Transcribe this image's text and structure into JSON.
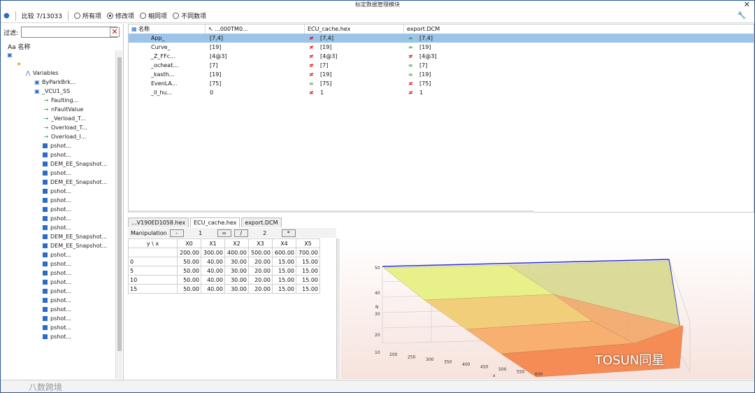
{
  "window": {
    "title": "标定数据管理模块",
    "close": "✕"
  },
  "toolbar": {
    "count_label": "比较",
    "count_value": "7/13033",
    "options": [
      {
        "label": "所有项",
        "selected": false
      },
      {
        "label": "修改项",
        "selected": true
      },
      {
        "label": "相同项",
        "selected": false
      },
      {
        "label": "不同数项",
        "selected": false
      }
    ]
  },
  "left": {
    "filter_label": "过滤:",
    "filter_value": "",
    "name_header": "Aa 名称",
    "tree": [
      {
        "label": "",
        "indent": 0,
        "icon": "folder"
      },
      {
        "label": "",
        "indent": 1,
        "icon": "star"
      },
      {
        "label": "Variables",
        "indent": 2,
        "icon": "variable"
      },
      {
        "label": "ByParkBrk...",
        "indent": 3,
        "icon": "folder"
      },
      {
        "label": "_VCU1_SS",
        "indent": 3,
        "icon": "folder"
      },
      {
        "label": "Faulting...",
        "indent": 4,
        "icon": "arrow"
      },
      {
        "label": "nFaultValue",
        "indent": 4,
        "icon": "arrow"
      },
      {
        "label": "_Verload_T...",
        "indent": 4,
        "icon": "arrow"
      },
      {
        "label": "Overload_T...",
        "indent": 4,
        "icon": "arrow"
      },
      {
        "label": "Overload_I...",
        "indent": 4,
        "icon": "arrow"
      },
      {
        "label": "pshot...",
        "indent": 4,
        "icon": "grid"
      },
      {
        "label": "pshot...",
        "indent": 4,
        "icon": "grid"
      },
      {
        "label": "DEM_EE_Snapshot...",
        "indent": 4,
        "icon": "grid"
      },
      {
        "label": "pshot...",
        "indent": 4,
        "icon": "grid"
      },
      {
        "label": "DEM_EE_Snapshot...",
        "indent": 4,
        "icon": "grid"
      },
      {
        "label": "pshot...",
        "indent": 4,
        "icon": "grid"
      },
      {
        "label": "pshot...",
        "indent": 4,
        "icon": "grid"
      },
      {
        "label": "pshot...",
        "indent": 4,
        "icon": "grid"
      },
      {
        "label": "pshot...",
        "indent": 4,
        "icon": "grid"
      },
      {
        "label": "pshot...",
        "indent": 4,
        "icon": "grid"
      },
      {
        "label": "DEM_EE_Snapshot...",
        "indent": 4,
        "icon": "grid"
      },
      {
        "label": "DEM_EE_Snapshot...",
        "indent": 4,
        "icon": "grid"
      },
      {
        "label": "pshot...",
        "indent": 4,
        "icon": "grid"
      },
      {
        "label": "pshot...",
        "indent": 4,
        "icon": "grid"
      },
      {
        "label": "pshot...",
        "indent": 4,
        "icon": "grid"
      },
      {
        "label": "pshot...",
        "indent": 4,
        "icon": "grid"
      },
      {
        "label": "pshot...",
        "indent": 4,
        "icon": "grid"
      },
      {
        "label": "pshot...",
        "indent": 4,
        "icon": "grid"
      },
      {
        "label": "pshot...",
        "indent": 4,
        "icon": "grid"
      },
      {
        "label": "pshot...",
        "indent": 4,
        "icon": "grid"
      },
      {
        "label": "pshot...",
        "indent": 4,
        "icon": "grid"
      },
      {
        "label": "pshot...",
        "indent": 4,
        "icon": "grid"
      }
    ]
  },
  "compare": {
    "headers": [
      "名称",
      "...000TM0...",
      "ECU_cache.hex",
      "export.DCM"
    ],
    "rows": [
      {
        "name": "App_",
        "v1": "[7,4]",
        "s2": "≠",
        "v2": "[7,4]",
        "s3": "=",
        "v3": "[7,4]",
        "selected": true
      },
      {
        "name": "Curve_",
        "v1": "[19]",
        "s2": "≠",
        "v2": "[19]",
        "s3": "=",
        "v3": "[19]"
      },
      {
        "name": "_Z_FFc...",
        "v1": "[4@3]",
        "s2": "≠",
        "v2": "[4@3]",
        "s3": "≠",
        "v3": "[4@3]"
      },
      {
        "name": "_ocheat...",
        "v1": "[7]",
        "s2": "≠",
        "v2": "[7]",
        "s3": "=",
        "v3": "[7]"
      },
      {
        "name": "_kasth...",
        "v1": "[19]",
        "s2": "≠",
        "v2": "[19]",
        "s3": "=",
        "v3": "[19]"
      },
      {
        "name": "EvenLA...",
        "v1": "[75]",
        "s2": "=",
        "v2": "[75]",
        "s3": "≠",
        "v3": "[75]"
      },
      {
        "name": "_ll_hu...",
        "v1": "0",
        "s2": "≠",
        "v2": "1",
        "s3": "≠",
        "v3": "1"
      }
    ]
  },
  "bottom_tabs": [
    "...V190ED1058.hex",
    "ECU_cache.hex",
    "export.DCM"
  ],
  "manipulation": {
    "label": "Manipulation",
    "minus": "-",
    "val1": "1",
    "eq": "=",
    "div": "/",
    "val2": "2",
    "times": "*"
  },
  "table": {
    "corner": "y \\ x",
    "cols": [
      "X0",
      "X1",
      "X2",
      "X3",
      "X4",
      "X5"
    ],
    "xvals": [
      "200.00",
      "300.00",
      "400.00",
      "500.00",
      "600.00",
      "700.00"
    ],
    "rows": [
      {
        "y": "0",
        "vals": [
          "50.00",
          "40.00",
          "30.00",
          "20.00",
          "15.00",
          "15.00"
        ]
      },
      {
        "y": "5",
        "vals": [
          "50.00",
          "40.00",
          "30.00",
          "20.00",
          "15.00",
          "15.00"
        ]
      },
      {
        "y": "10",
        "vals": [
          "50.00",
          "40.00",
          "30.00",
          "20.00",
          "15.00",
          "15.00"
        ]
      },
      {
        "y": "15",
        "vals": [
          "50.00",
          "40.00",
          "30.00",
          "20.00",
          "15.00",
          "15.00"
        ]
      }
    ]
  },
  "chart3d": {
    "zlabel": "N",
    "xlabel": "x",
    "xticks": [
      "200",
      "250",
      "300",
      "350",
      "400",
      "450",
      "500",
      "550",
      "600"
    ],
    "zticks": [
      "10",
      "20",
      "30",
      "40",
      "50"
    ]
  },
  "watermarks": {
    "left": "八数跨境",
    "right": "TOSUN同星"
  },
  "colors": {
    "selection": "#9cc4e8",
    "neq": "#dd0000",
    "eq": "#2a9a3a"
  }
}
